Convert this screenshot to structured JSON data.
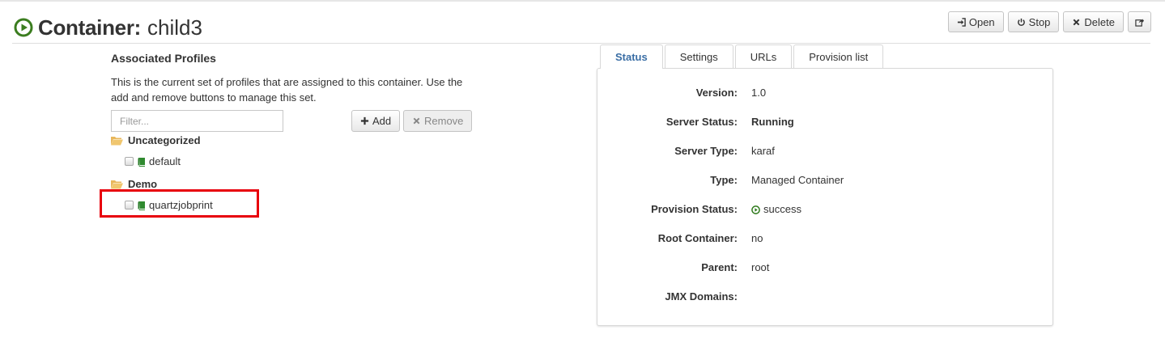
{
  "header": {
    "title_label": "Container:",
    "title_name": "child3",
    "actions": {
      "open": "Open",
      "stop": "Stop",
      "delete": "Delete"
    }
  },
  "profiles": {
    "section_title": "Associated Profiles",
    "description": "This is the current set of profiles that are assigned to this container. Use the add and remove buttons to manage this set.",
    "filter_placeholder": "Filter...",
    "add_label": "Add",
    "remove_label": "Remove",
    "groups": [
      {
        "name": "Uncategorized",
        "items": [
          "default"
        ]
      },
      {
        "name": "Demo",
        "items": [
          "quartzjobprint"
        ]
      }
    ]
  },
  "tabs": [
    "Status",
    "Settings",
    "URLs",
    "Provision list"
  ],
  "status": {
    "version_label": "Version:",
    "version": "1.0",
    "server_status_label": "Server Status:",
    "server_status": "Running",
    "server_type_label": "Server Type:",
    "server_type": "karaf",
    "type_label": "Type:",
    "type": "Managed Container",
    "provision_status_label": "Provision Status:",
    "provision_status": "success",
    "root_container_label": "Root Container:",
    "root_container": "no",
    "parent_label": "Parent:",
    "parent": "root",
    "jmx_domains_label": "JMX Domains:"
  },
  "colors": {
    "accent_green": "#2e7a1b",
    "link_blue": "#2a6fb5",
    "tab_active": "#3a6ea5",
    "highlight_red": "#e8000b"
  }
}
